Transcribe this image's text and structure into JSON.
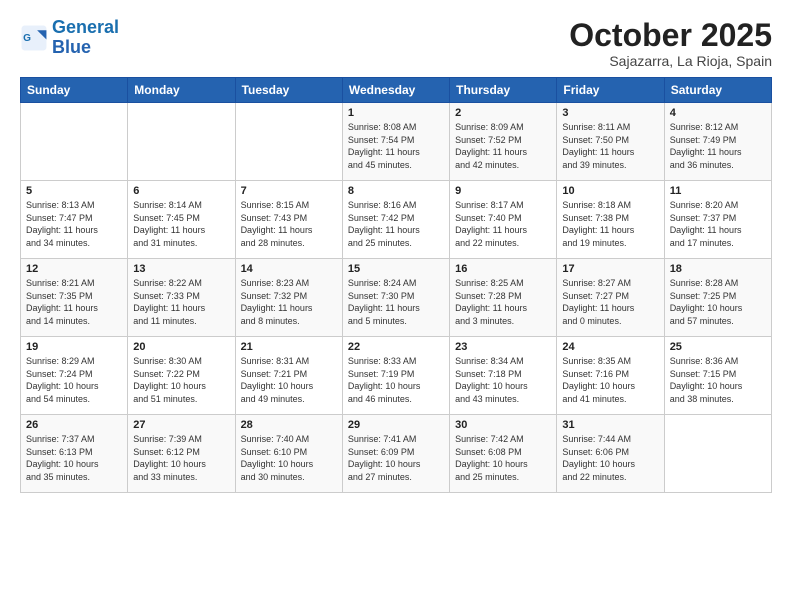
{
  "logo": {
    "line1": "General",
    "line2": "Blue"
  },
  "header": {
    "month": "October 2025",
    "location": "Sajazarra, La Rioja, Spain"
  },
  "days_of_week": [
    "Sunday",
    "Monday",
    "Tuesday",
    "Wednesday",
    "Thursday",
    "Friday",
    "Saturday"
  ],
  "weeks": [
    [
      {
        "day": "",
        "info": ""
      },
      {
        "day": "",
        "info": ""
      },
      {
        "day": "",
        "info": ""
      },
      {
        "day": "1",
        "info": "Sunrise: 8:08 AM\nSunset: 7:54 PM\nDaylight: 11 hours\nand 45 minutes."
      },
      {
        "day": "2",
        "info": "Sunrise: 8:09 AM\nSunset: 7:52 PM\nDaylight: 11 hours\nand 42 minutes."
      },
      {
        "day": "3",
        "info": "Sunrise: 8:11 AM\nSunset: 7:50 PM\nDaylight: 11 hours\nand 39 minutes."
      },
      {
        "day": "4",
        "info": "Sunrise: 8:12 AM\nSunset: 7:49 PM\nDaylight: 11 hours\nand 36 minutes."
      }
    ],
    [
      {
        "day": "5",
        "info": "Sunrise: 8:13 AM\nSunset: 7:47 PM\nDaylight: 11 hours\nand 34 minutes."
      },
      {
        "day": "6",
        "info": "Sunrise: 8:14 AM\nSunset: 7:45 PM\nDaylight: 11 hours\nand 31 minutes."
      },
      {
        "day": "7",
        "info": "Sunrise: 8:15 AM\nSunset: 7:43 PM\nDaylight: 11 hours\nand 28 minutes."
      },
      {
        "day": "8",
        "info": "Sunrise: 8:16 AM\nSunset: 7:42 PM\nDaylight: 11 hours\nand 25 minutes."
      },
      {
        "day": "9",
        "info": "Sunrise: 8:17 AM\nSunset: 7:40 PM\nDaylight: 11 hours\nand 22 minutes."
      },
      {
        "day": "10",
        "info": "Sunrise: 8:18 AM\nSunset: 7:38 PM\nDaylight: 11 hours\nand 19 minutes."
      },
      {
        "day": "11",
        "info": "Sunrise: 8:20 AM\nSunset: 7:37 PM\nDaylight: 11 hours\nand 17 minutes."
      }
    ],
    [
      {
        "day": "12",
        "info": "Sunrise: 8:21 AM\nSunset: 7:35 PM\nDaylight: 11 hours\nand 14 minutes."
      },
      {
        "day": "13",
        "info": "Sunrise: 8:22 AM\nSunset: 7:33 PM\nDaylight: 11 hours\nand 11 minutes."
      },
      {
        "day": "14",
        "info": "Sunrise: 8:23 AM\nSunset: 7:32 PM\nDaylight: 11 hours\nand 8 minutes."
      },
      {
        "day": "15",
        "info": "Sunrise: 8:24 AM\nSunset: 7:30 PM\nDaylight: 11 hours\nand 5 minutes."
      },
      {
        "day": "16",
        "info": "Sunrise: 8:25 AM\nSunset: 7:28 PM\nDaylight: 11 hours\nand 3 minutes."
      },
      {
        "day": "17",
        "info": "Sunrise: 8:27 AM\nSunset: 7:27 PM\nDaylight: 11 hours\nand 0 minutes."
      },
      {
        "day": "18",
        "info": "Sunrise: 8:28 AM\nSunset: 7:25 PM\nDaylight: 10 hours\nand 57 minutes."
      }
    ],
    [
      {
        "day": "19",
        "info": "Sunrise: 8:29 AM\nSunset: 7:24 PM\nDaylight: 10 hours\nand 54 minutes."
      },
      {
        "day": "20",
        "info": "Sunrise: 8:30 AM\nSunset: 7:22 PM\nDaylight: 10 hours\nand 51 minutes."
      },
      {
        "day": "21",
        "info": "Sunrise: 8:31 AM\nSunset: 7:21 PM\nDaylight: 10 hours\nand 49 minutes."
      },
      {
        "day": "22",
        "info": "Sunrise: 8:33 AM\nSunset: 7:19 PM\nDaylight: 10 hours\nand 46 minutes."
      },
      {
        "day": "23",
        "info": "Sunrise: 8:34 AM\nSunset: 7:18 PM\nDaylight: 10 hours\nand 43 minutes."
      },
      {
        "day": "24",
        "info": "Sunrise: 8:35 AM\nSunset: 7:16 PM\nDaylight: 10 hours\nand 41 minutes."
      },
      {
        "day": "25",
        "info": "Sunrise: 8:36 AM\nSunset: 7:15 PM\nDaylight: 10 hours\nand 38 minutes."
      }
    ],
    [
      {
        "day": "26",
        "info": "Sunrise: 7:37 AM\nSunset: 6:13 PM\nDaylight: 10 hours\nand 35 minutes."
      },
      {
        "day": "27",
        "info": "Sunrise: 7:39 AM\nSunset: 6:12 PM\nDaylight: 10 hours\nand 33 minutes."
      },
      {
        "day": "28",
        "info": "Sunrise: 7:40 AM\nSunset: 6:10 PM\nDaylight: 10 hours\nand 30 minutes."
      },
      {
        "day": "29",
        "info": "Sunrise: 7:41 AM\nSunset: 6:09 PM\nDaylight: 10 hours\nand 27 minutes."
      },
      {
        "day": "30",
        "info": "Sunrise: 7:42 AM\nSunset: 6:08 PM\nDaylight: 10 hours\nand 25 minutes."
      },
      {
        "day": "31",
        "info": "Sunrise: 7:44 AM\nSunset: 6:06 PM\nDaylight: 10 hours\nand 22 minutes."
      },
      {
        "day": "",
        "info": ""
      }
    ]
  ]
}
